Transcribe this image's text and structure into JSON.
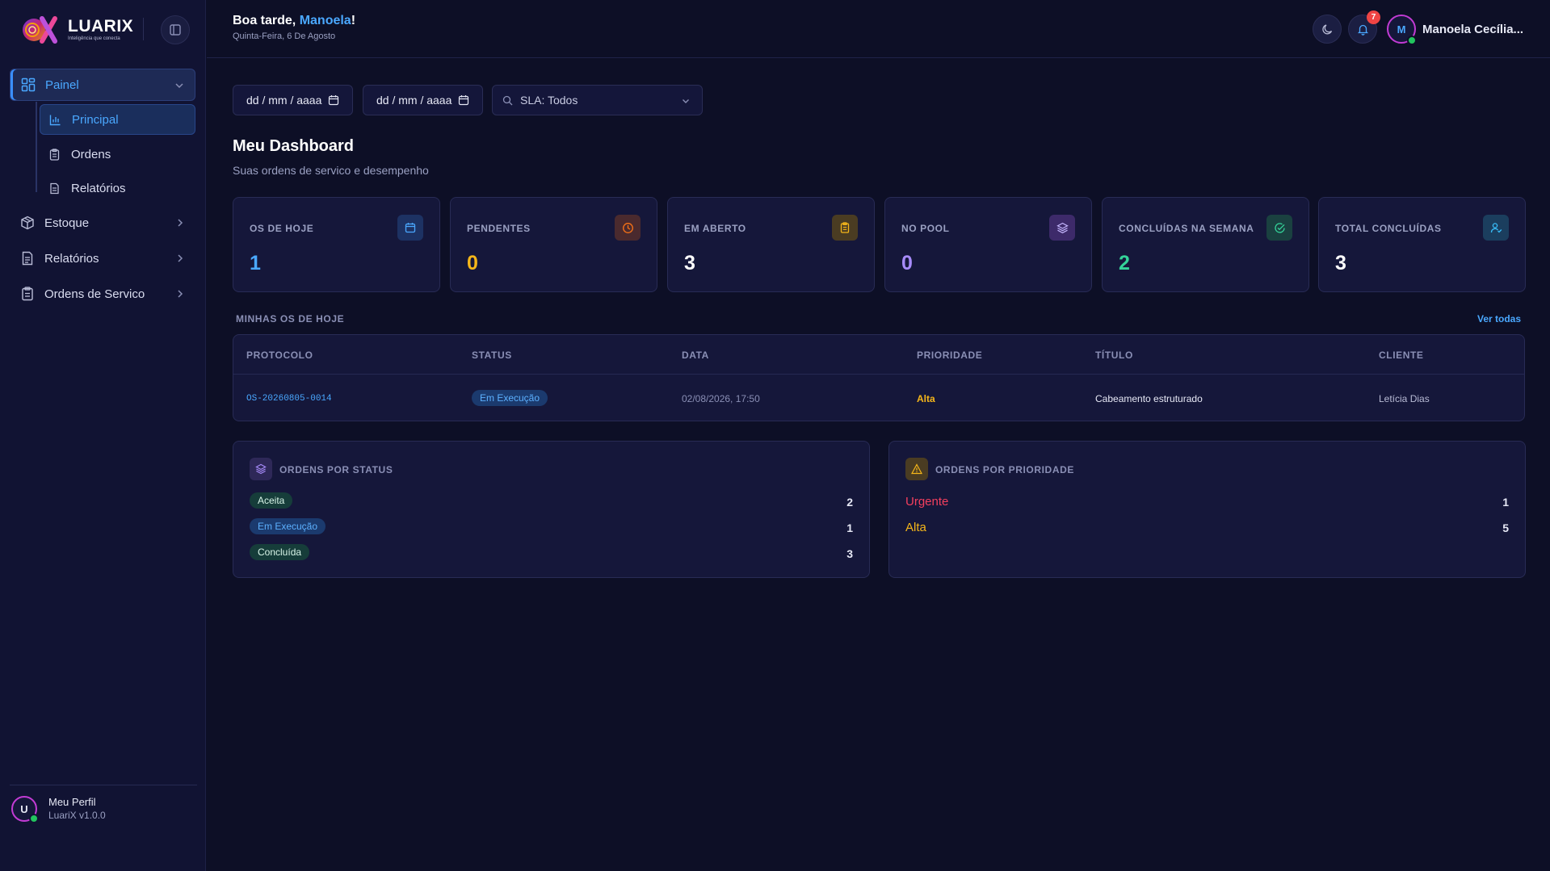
{
  "brand": {
    "name": "LUARIX",
    "tagline": "Inteligência que conecta"
  },
  "sidebar": {
    "items": [
      {
        "label": "Painel"
      },
      {
        "label": "Estoque"
      },
      {
        "label": "Relatórios"
      },
      {
        "label": "Ordens de Servico"
      }
    ],
    "subitems": [
      {
        "label": "Principal"
      },
      {
        "label": "Ordens"
      },
      {
        "label": "Relatórios"
      }
    ],
    "profile": {
      "initial": "U",
      "name": "Meu Perfil",
      "version": "LuariX v1.0.0"
    }
  },
  "header": {
    "greeting_prefix": "Boa tarde, ",
    "greeting_name": "Manoela",
    "greeting_suffix": "!",
    "date": "Quinta-Feira, 6 De Agosto",
    "notifications_count": "7",
    "user_initial": "M",
    "user_name": "Manoela Cecília..."
  },
  "filters": {
    "date_from": "dd / mm / aaaa",
    "date_to": "dd / mm / aaaa",
    "sla": "SLA: Todos"
  },
  "dashboard": {
    "title": "Meu Dashboard",
    "subtitle": "Suas ordens de servico e desempenho"
  },
  "kpis": [
    {
      "label": "OS DE HOJE",
      "value": "1",
      "color": "#4aa8ff",
      "icon": "calendar-icon"
    },
    {
      "label": "PENDENTES",
      "value": "0",
      "color": "#f5b61a",
      "icon": "clock-icon"
    },
    {
      "label": "EM ABERTO",
      "value": "3",
      "color": "#ffffff",
      "icon": "clipboard-icon"
    },
    {
      "label": "NO POOL",
      "value": "0",
      "color": "#a78bfa",
      "icon": "layers-icon"
    },
    {
      "label": "CONCLUÍDAS NA SEMANA",
      "value": "2",
      "color": "#34d399",
      "icon": "check-circle-icon"
    },
    {
      "label": "TOTAL CONCLUÍDAS",
      "value": "3",
      "color": "#ffffff",
      "icon": "user-check-icon"
    }
  ],
  "today_orders": {
    "title": "MINHAS OS DE HOJE",
    "see_all": "Ver todas",
    "columns": [
      "PROTOCOLO",
      "STATUS",
      "DATA",
      "PRIORIDADE",
      "TÍTULO",
      "CLIENTE"
    ],
    "rows": [
      {
        "protocol": "OS-20260805-0014",
        "status": "Em Execução",
        "date": "02/08/2026, 17:50",
        "priority": "Alta",
        "title": "Cabeamento estruturado",
        "client": "Letícia Dias"
      }
    ]
  },
  "by_status": {
    "title": "ORDENS POR STATUS",
    "items": [
      {
        "label": "Aceita",
        "count": "2"
      },
      {
        "label": "Em Execução",
        "count": "1"
      },
      {
        "label": "Concluída",
        "count": "3"
      }
    ]
  },
  "by_priority": {
    "title": "ORDENS POR PRIORIDADE",
    "items": [
      {
        "label": "Urgente",
        "count": "1",
        "color": "#f43f5e"
      },
      {
        "label": "Alta",
        "count": "5",
        "color": "#f5b61a"
      }
    ]
  },
  "colors": {
    "accent": "#4aa8ff",
    "background": "#0d0f26",
    "sidebar": "#111333",
    "card": "#15173a",
    "online": "#22c55e"
  }
}
